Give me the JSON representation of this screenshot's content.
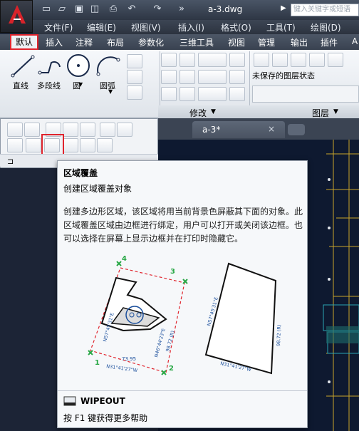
{
  "title_bar": {
    "doc_title": "a-3.dwg",
    "search_placeholder": "键入关键字或短语",
    "qa_icons": [
      "new-icon",
      "open-icon",
      "save-icon",
      "save-as-icon",
      "print-icon",
      "undo-icon",
      "redo-icon",
      "more-icon"
    ]
  },
  "menu": [
    "文件(F)",
    "编辑(E)",
    "视图(V)",
    "插入(I)",
    "格式(O)",
    "工具(T)",
    "绘图(D)"
  ],
  "ribbon_tabs": [
    "默认",
    "插入",
    "注释",
    "布局",
    "参数化",
    "三维工具",
    "视图",
    "管理",
    "输出",
    "插件",
    "A"
  ],
  "draw_panel": {
    "tools": [
      "直线",
      "多段线",
      "圆",
      "圆弧"
    ]
  },
  "modify_panel": {
    "label": "修改"
  },
  "layer_panel": {
    "label": "图层",
    "state": "未保存的图层状态"
  },
  "doc_tab": {
    "label": "a-3*",
    "close": "×"
  },
  "tooltip": {
    "title": "区域覆盖",
    "subtitle": "创建区域覆盖对象",
    "description": "创建多边形区域，该区域将用当前背景色屏蔽其下面的对象。此区域覆盖区域由边框进行绑定，用户可以打开或关闭该边框。也可以选择在屏幕上显示边框并在打印时隐藏它。",
    "command": "WIPEOUT",
    "help": "按 F1 键获得更多帮助",
    "figure_labels": {
      "points": [
        "1",
        "2",
        "3",
        "4"
      ],
      "dims": [
        "N57°45'31\"E",
        "N46°44'23\"E",
        "98.72 (R)",
        "73.95",
        "N31°41'27\"W",
        "N57°45'31\"E",
        "98.72 (R)",
        "N31°41'27\"W"
      ]
    }
  },
  "colors": {
    "accent_red": "#e0242d",
    "canvas": "#0e1930"
  }
}
